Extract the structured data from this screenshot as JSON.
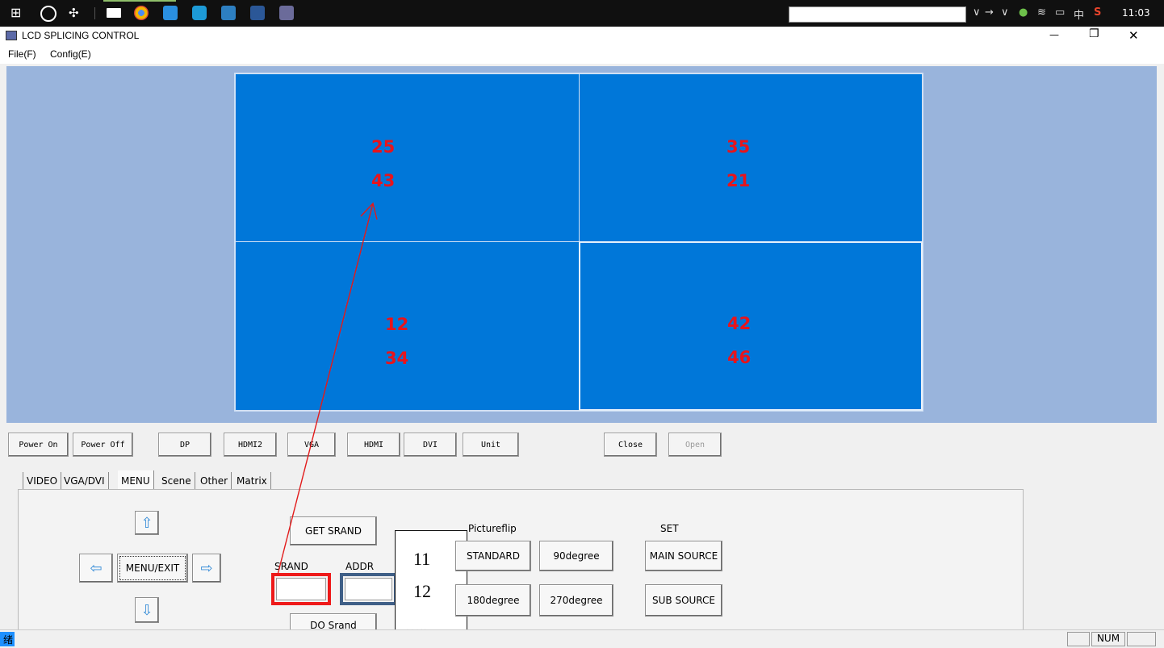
{
  "taskbar": {
    "search_value": "",
    "time": "11:03",
    "ime_label": "中"
  },
  "window": {
    "title": "LCD SPLICING CONTROL",
    "menu": [
      "File(F)",
      "Config(E)"
    ],
    "min_glyph": "—",
    "max_glyph": "❐",
    "close_glyph": "✕"
  },
  "wall": {
    "cells": [
      {
        "top_num": "25",
        "bottom_num": "43"
      },
      {
        "top_num": "35",
        "bottom_num": "21"
      },
      {
        "top_num": "12",
        "bottom_num": "34"
      },
      {
        "top_num": "42",
        "bottom_num": "46"
      }
    ]
  },
  "controls": {
    "buttons": [
      "Power On",
      "Power Off",
      "DP",
      "HDMI2",
      "VGA",
      "HDMI",
      "DVI",
      "Unit",
      "Close",
      "Open"
    ],
    "tabs": [
      "VIDEO",
      "VGA/DVI",
      "MENU",
      "Scene",
      "Other",
      "Matrix"
    ]
  },
  "menu_panel": {
    "menu_exit": "MENU/EXIT",
    "get_srand": "GET SRAND",
    "do_srand": "DO Srand",
    "srand_label": "SRAND",
    "addr_label": "ADDR",
    "srand_value": "",
    "addr_value": "",
    "pictureflip_label": "Pictureflip",
    "flip_buttons": [
      "STANDARD",
      "90degree",
      "180degree",
      "270degree"
    ],
    "set_label": "SET",
    "main_source": "MAIN SOURCE",
    "sub_source": "SUB SOURCE"
  },
  "annotation": {
    "lines": [
      "11",
      "12",
      "….."
    ]
  },
  "status": {
    "left_text": "绪",
    "num": "NUM"
  }
}
